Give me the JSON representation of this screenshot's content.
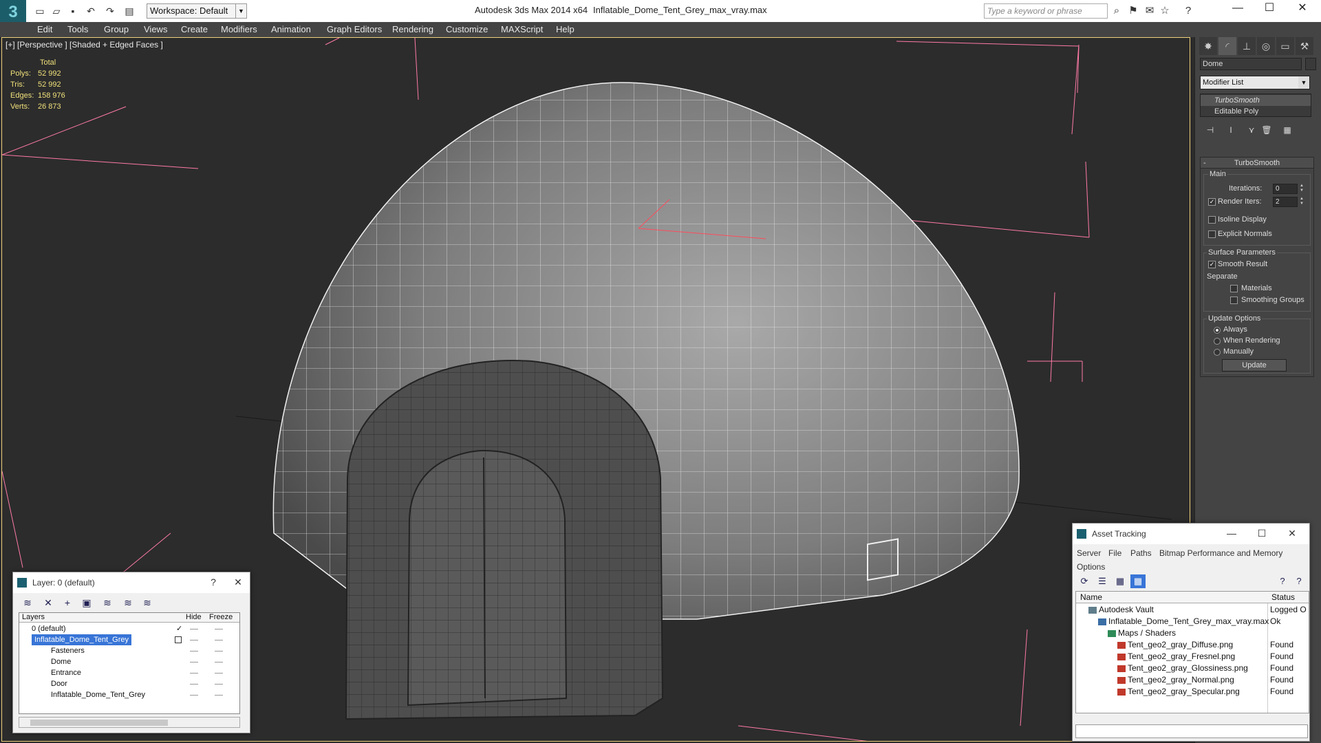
{
  "window": {
    "app_title": "Autodesk 3ds Max  2014 x64",
    "file_title": "Inflatable_Dome_Tent_Grey_max_vray.max",
    "workspace": "Workspace: Default",
    "search_placeholder": "Type a keyword or phrase"
  },
  "menu": [
    "Edit",
    "Tools",
    "Group",
    "Views",
    "Create",
    "Modifiers",
    "Animation",
    "Graph Editors",
    "Rendering",
    "Customize",
    "MAXScript",
    "Help"
  ],
  "viewport": {
    "label": "[+] [Perspective ] [Shaded + Edged Faces ]",
    "stats": {
      "header": "Total",
      "rows": [
        {
          "key": "Polys:",
          "value": "52 992"
        },
        {
          "key": "Tris:",
          "value": "52 992"
        },
        {
          "key": "Edges:",
          "value": "158 976"
        },
        {
          "key": "Verts:",
          "value": "26 873"
        }
      ]
    }
  },
  "command_panel": {
    "object_name": "Dome",
    "modifier_list": "Modifier List",
    "stack": [
      "TurboSmooth",
      "Editable Poly"
    ],
    "rollout_title": "TurboSmooth",
    "main_label": "Main",
    "iterations_label": "Iterations:",
    "iterations_value": "0",
    "render_iters_label": "Render Iters:",
    "render_iters_value": "2",
    "isoline_label": "Isoline Display",
    "explicit_normals_label": "Explicit Normals",
    "surface_params_label": "Surface Parameters",
    "smooth_result_label": "Smooth Result",
    "separate_label": "Separate",
    "materials_label": "Materials",
    "smoothing_groups_label": "Smoothing Groups",
    "update_options_label": "Update Options",
    "always_label": "Always",
    "when_rendering_label": "When Rendering",
    "manually_label": "Manually",
    "update_button": "Update"
  },
  "layer_panel": {
    "title": "Layer: 0 (default)",
    "help": "?",
    "col_layers": "Layers",
    "col_hide": "Hide",
    "col_freeze": "Freeze",
    "rows": [
      "0 (default)",
      "Inflatable_Dome_Tent_Grey",
      "Fasteners",
      "Dome",
      "Entrance",
      "Door",
      "Inflatable_Dome_Tent_Grey"
    ]
  },
  "asset_panel": {
    "title": "Asset Tracking",
    "menu": [
      "Server",
      "File",
      "Paths",
      "Bitmap Performance and Memory",
      "Options"
    ],
    "col_name": "Name",
    "col_status": "Status",
    "rows": [
      {
        "name": "Autodesk Vault",
        "status": "Logged O"
      },
      {
        "name": "Inflatable_Dome_Tent_Grey_max_vray.max",
        "status": "Ok"
      },
      {
        "name": "Maps / Shaders",
        "status": ""
      },
      {
        "name": "Tent_geo2_gray_Diffuse.png",
        "status": "Found"
      },
      {
        "name": "Tent_geo2_gray_Fresnel.png",
        "status": "Found"
      },
      {
        "name": "Tent_geo2_gray_Glossiness.png",
        "status": "Found"
      },
      {
        "name": "Tent_geo2_gray_Normal.png",
        "status": "Found"
      },
      {
        "name": "Tent_geo2_gray_Specular.png",
        "status": "Found"
      }
    ]
  }
}
